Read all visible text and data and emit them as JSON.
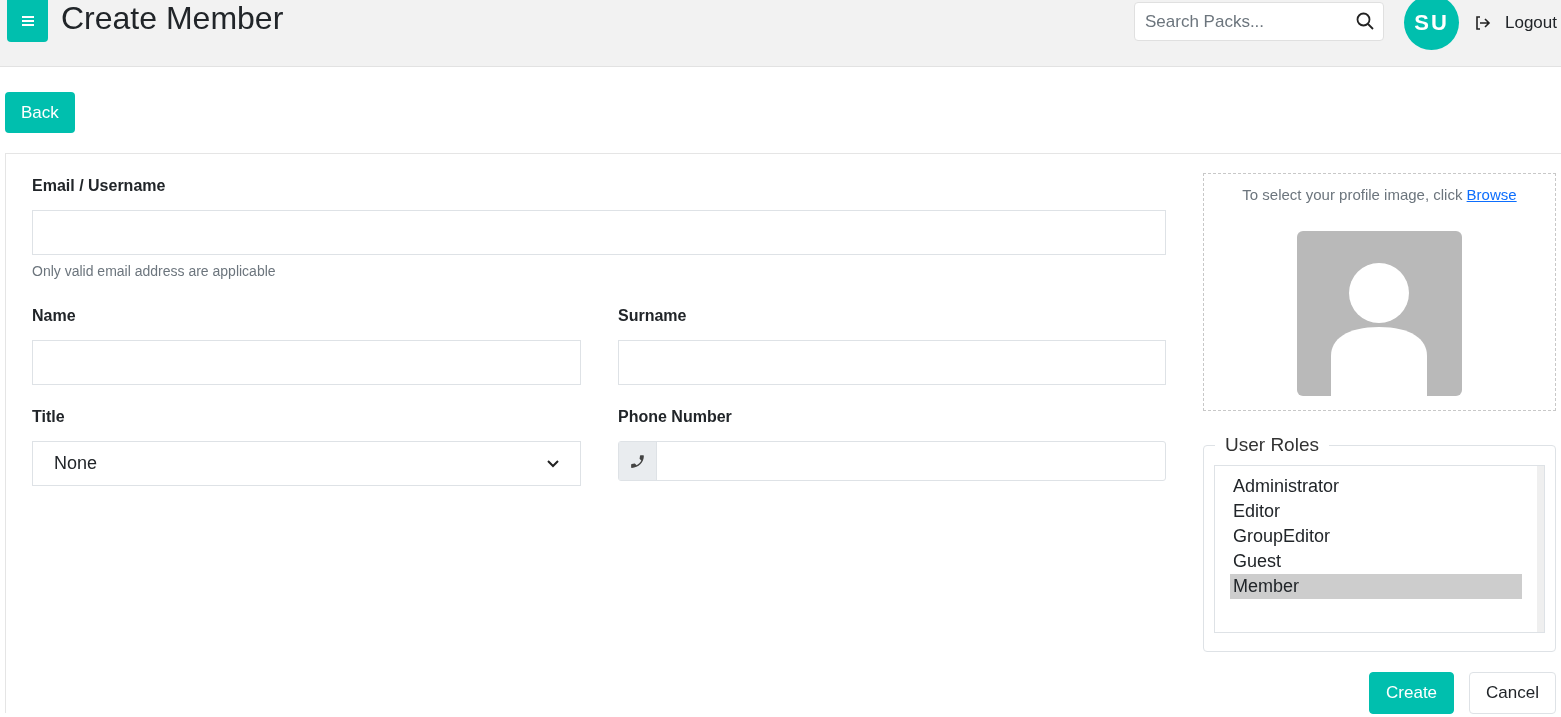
{
  "header": {
    "title": "Create Member",
    "search": {
      "placeholder": "Search Packs..."
    },
    "avatar": "SU",
    "logout": "Logout"
  },
  "back_button": "Back",
  "form": {
    "email": {
      "label": "Email / Username",
      "help": "Only valid email address are applicable"
    },
    "name": {
      "label": "Name"
    },
    "surname": {
      "label": "Surname"
    },
    "title": {
      "label": "Title",
      "value": "None"
    },
    "phone": {
      "label": "Phone Number"
    }
  },
  "profile_image": {
    "prompt": "To select your profile image, click",
    "link": "Browse"
  },
  "user_roles": {
    "legend": "User Roles",
    "items": [
      {
        "label": "Administrator",
        "selected": false
      },
      {
        "label": "Editor",
        "selected": false
      },
      {
        "label": "GroupEditor",
        "selected": false
      },
      {
        "label": "Guest",
        "selected": false
      },
      {
        "label": "Member",
        "selected": true
      }
    ]
  },
  "actions": [
    "Create",
    "Cancel"
  ]
}
